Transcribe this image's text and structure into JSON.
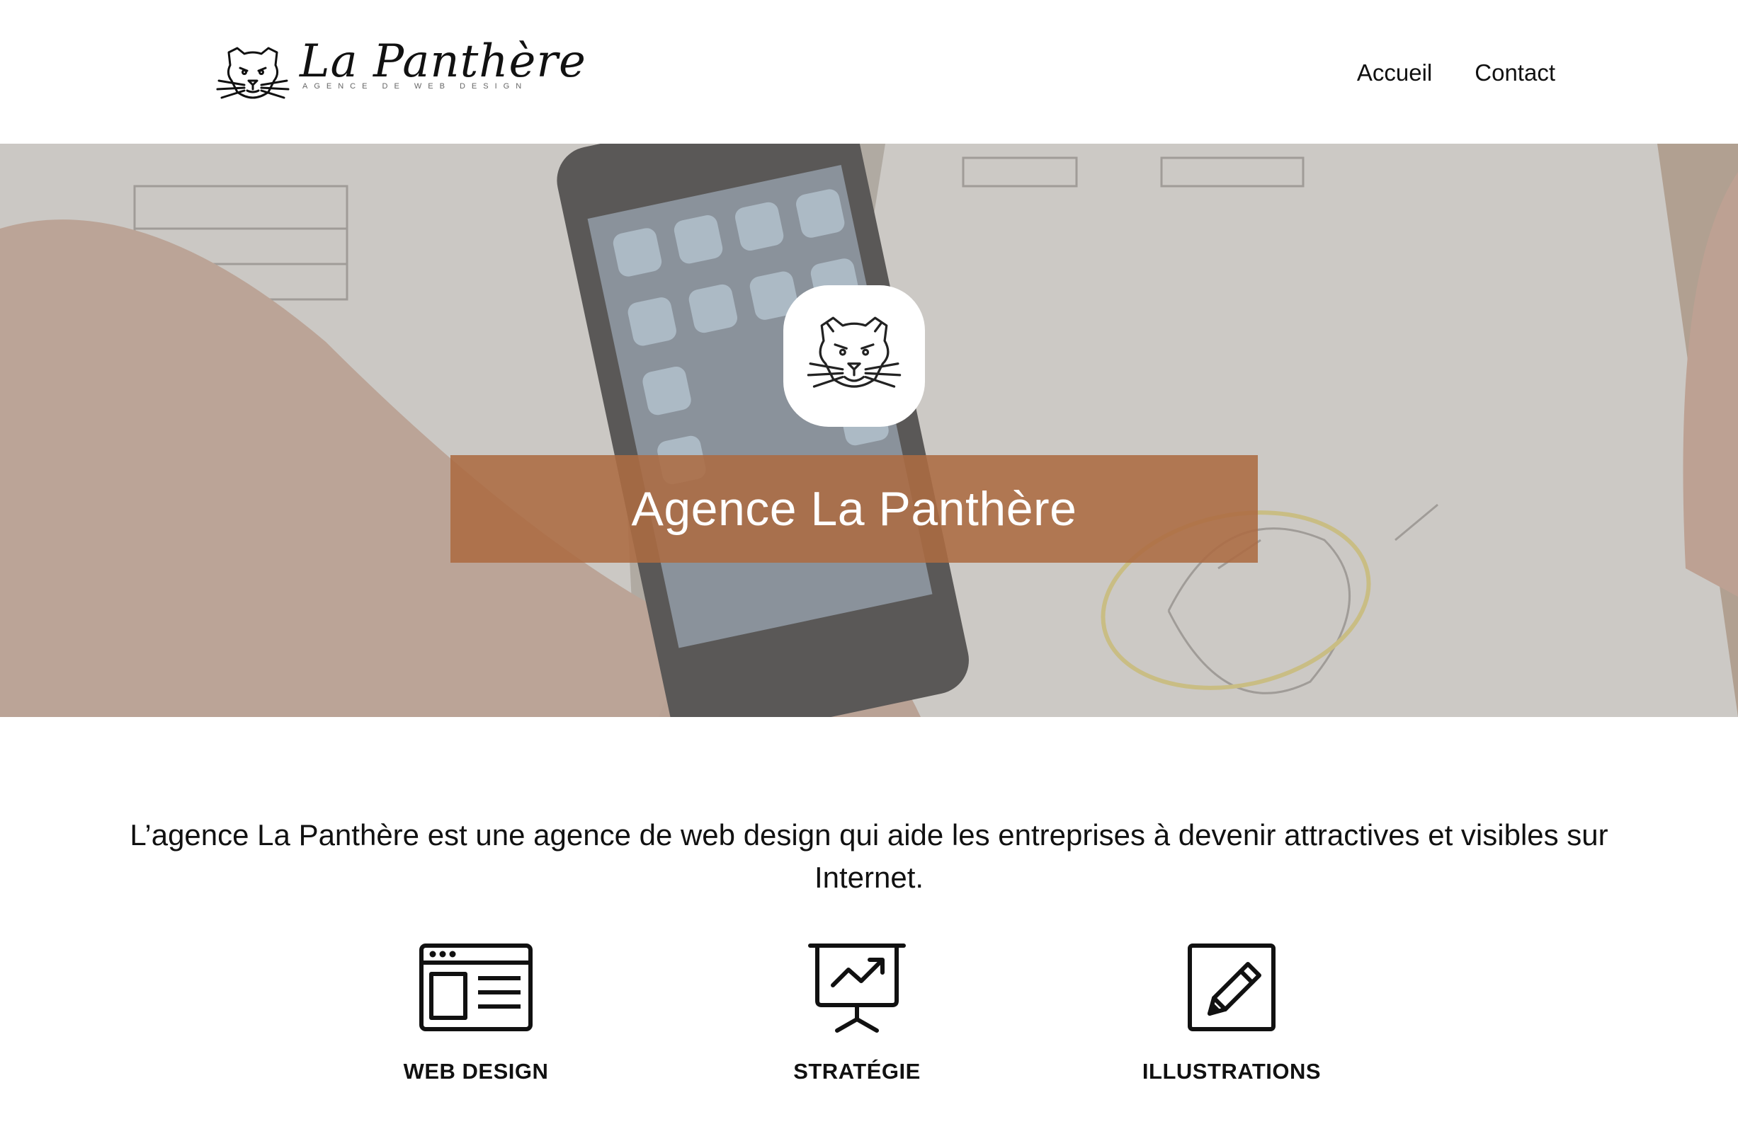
{
  "brand": {
    "name": "La Panthère",
    "tagline": "AGENCE DE WEB DESIGN",
    "logo_icon": "panther-head-icon"
  },
  "nav": {
    "items": [
      {
        "label": "Accueil"
      },
      {
        "label": "Contact"
      }
    ]
  },
  "hero": {
    "title": "Agence La Panthère",
    "badge_icon": "panther-head-icon",
    "band_color": "#ac6b42"
  },
  "intro": {
    "text": "L’agence La Panthère est une agence de web design qui aide les entreprises à devenir attractives et visibles sur Internet."
  },
  "services": [
    {
      "label": "WEB DESIGN",
      "icon": "browser-window-icon"
    },
    {
      "label": "STRATÉGIE",
      "icon": "presentation-chart-icon"
    },
    {
      "label": "ILLUSTRATIONS",
      "icon": "pencil-icon"
    }
  ]
}
